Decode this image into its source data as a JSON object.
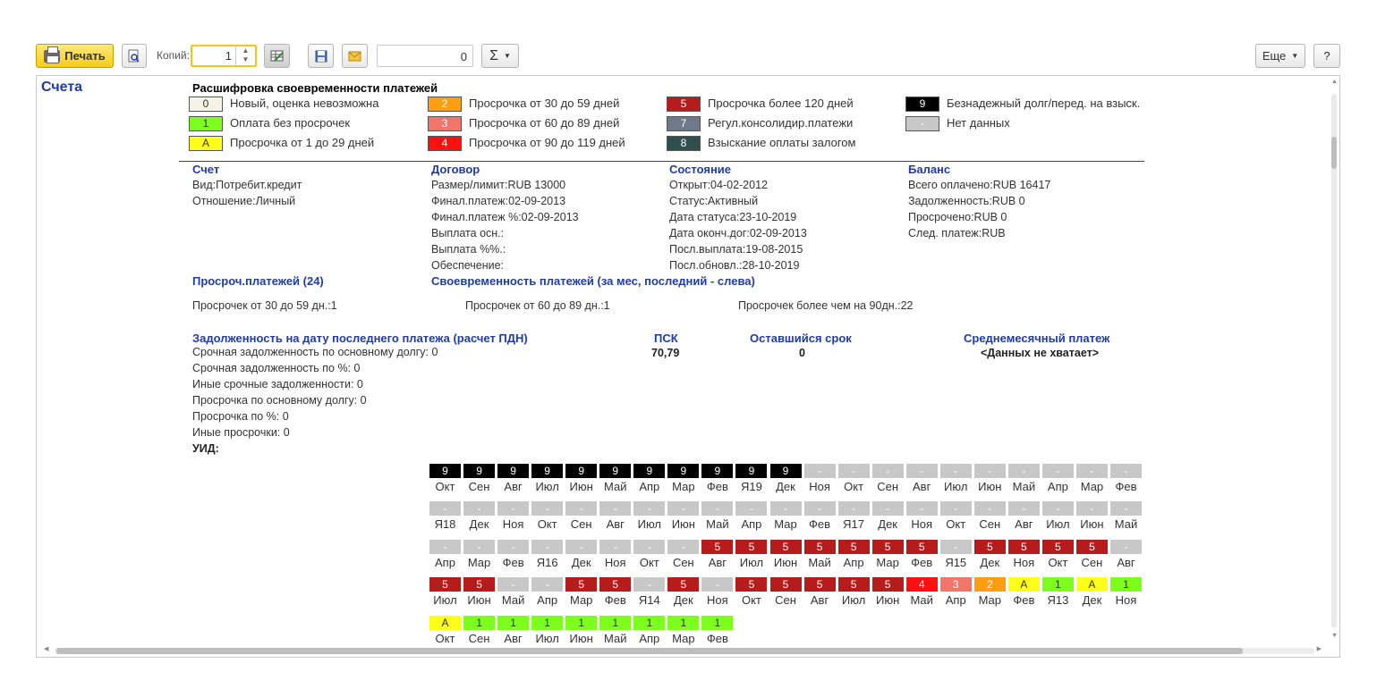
{
  "toolbar": {
    "print_label": "Печать",
    "copies_label": "Копий:",
    "copies_value": "1",
    "sum_value": "0",
    "sigma_label": "Σ",
    "more_label": "Еще",
    "help_label": "?"
  },
  "page_title": "Счета",
  "legend": {
    "title": "Расшифровка своевременности  платежей",
    "items": [
      {
        "code": "0",
        "text": "Новый, оценка невозможна",
        "color": "#f5f3e6",
        "fg": "#333"
      },
      {
        "code": "1",
        "text": "Оплата без просрочек",
        "color": "#7dff1e",
        "fg": "#333"
      },
      {
        "code": "A",
        "text": "Просрочка от 1 до 29 дней",
        "color": "#ffff1a",
        "fg": "#333"
      },
      {
        "code": "2",
        "text": "Просрочка от 30 до 59 дней",
        "color": "#ff9e12",
        "fg": "#fff"
      },
      {
        "code": "3",
        "text": "Просрочка от 60 до 89 дней",
        "color": "#f2756a",
        "fg": "#fff"
      },
      {
        "code": "4",
        "text": "Просрочка от 90 до 119 дней",
        "color": "#ff1010",
        "fg": "#fff"
      },
      {
        "code": "5",
        "text": "Просрочка более 120 дней",
        "color": "#b71c1c",
        "fg": "#fff"
      },
      {
        "code": "7",
        "text": "Регул.консолидир.платежи",
        "color": "#6e7a8a",
        "fg": "#fff"
      },
      {
        "code": "8",
        "text": "Взыскание оплаты залогом",
        "color": "#2f4f4f",
        "fg": "#fff"
      },
      {
        "code": "9",
        "text": "Безнадежный долг/перед. на взыск.",
        "color": "#000000",
        "fg": "#fff"
      },
      {
        "code": "-",
        "text": "Нет данных",
        "color": "#c8c8c8",
        "fg": "#fff"
      }
    ]
  },
  "account": {
    "heading": "Счет",
    "lines": [
      "Вид:Потребит.кредит",
      "Отношение:Личный"
    ]
  },
  "contract": {
    "heading": "Договор",
    "lines": [
      "Размер/лимит:RUB 13000",
      "Финал.платеж:02-09-2013",
      "Финал.платеж %:02-09-2013",
      "Выплата осн.:",
      "Выплата %%.:",
      "Обеспечение:"
    ]
  },
  "state": {
    "heading": "Состояние",
    "lines": [
      "Открыт:04-02-2012",
      "Статус:Активный",
      "Дата статуса:23-10-2019",
      "Дата оконч.дог:02-09-2013",
      "Посл.выплата:19-08-2015",
      "Посл.обновл.:28-10-2019"
    ]
  },
  "balance": {
    "heading": "Баланс",
    "lines": [
      "Всего оплачено:RUB 16417",
      "Задолженность:RUB 0",
      "Просрочено:RUB 0",
      "След. платеж:RUB"
    ]
  },
  "overdue": {
    "heading": "Просроч.платежей (24)",
    "timeliness_heading": "Своевременность платежей (за  мес, последний - слева)",
    "items": [
      "Просрочек от 30 до 59 дн.:1",
      "Просрочек от 60 до 89 дн.:1",
      "Просрочек более чем на 90дн.:22"
    ]
  },
  "debt": {
    "heading": "Задолженность на дату последнего платежа (расчет ПДН)",
    "lines": [
      "Срочная задолженность по основному долгу: 0",
      "Срочная задолженность по %: 0",
      "Иные срочные задолженности: 0",
      "Просрочка по основному долгу: 0",
      "Просрочка по %: 0",
      "Иные просрочки: 0",
      "УИД:"
    ],
    "psk_heading": "ПСК",
    "psk_value": "70,79",
    "term_heading": "Оставшийся срок",
    "term_value": "0",
    "avg_heading": "Среднемесячный платеж",
    "avg_value": "<Данных не хватает>"
  },
  "history": [
    {
      "codes": [
        "9",
        "9",
        "9",
        "9",
        "9",
        "9",
        "9",
        "9",
        "9",
        "9",
        "9",
        "-",
        "-",
        "-",
        "-",
        "-",
        "-",
        "-",
        "-",
        "-",
        "-"
      ],
      "months": [
        "Окт",
        "Сен",
        "Авг",
        "Июл",
        "Июн",
        "Май",
        "Апр",
        "Мар",
        "Фев",
        "Я19",
        "Дек",
        "Ноя",
        "Окт",
        "Сен",
        "Авг",
        "Июл",
        "Июн",
        "Май",
        "Апр",
        "Мар",
        "Фев"
      ]
    },
    {
      "codes": [
        "-",
        "-",
        "-",
        "-",
        "-",
        "-",
        "-",
        "-",
        "-",
        "-",
        "-",
        "-",
        "-",
        "-",
        "-",
        "-",
        "-",
        "-",
        "-",
        "-",
        "-"
      ],
      "months": [
        "Я18",
        "Дек",
        "Ноя",
        "Окт",
        "Сен",
        "Авг",
        "Июл",
        "Июн",
        "Май",
        "Апр",
        "Мар",
        "Фев",
        "Я17",
        "Дек",
        "Ноя",
        "Окт",
        "Сен",
        "Авг",
        "Июл",
        "Июн",
        "Май"
      ]
    },
    {
      "codes": [
        "-",
        "-",
        "-",
        "-",
        "-",
        "-",
        "-",
        "-",
        "5",
        "5",
        "5",
        "5",
        "5",
        "5",
        "5",
        "-",
        "5",
        "5",
        "5",
        "5",
        "-"
      ],
      "months": [
        "Апр",
        "Мар",
        "Фев",
        "Я16",
        "Дек",
        "Ноя",
        "Окт",
        "Сен",
        "Авг",
        "Июл",
        "Июн",
        "Май",
        "Апр",
        "Мар",
        "Фев",
        "Я15",
        "Дек",
        "Ноя",
        "Окт",
        "Сен",
        "Авг"
      ]
    },
    {
      "codes": [
        "5",
        "5",
        "-",
        "-",
        "5",
        "5",
        "-",
        "5",
        "-",
        "5",
        "5",
        "5",
        "5",
        "5",
        "4",
        "3",
        "2",
        "A",
        "1",
        "A",
        "1"
      ],
      "months": [
        "Июл",
        "Июн",
        "Май",
        "Апр",
        "Мар",
        "Фев",
        "Я14",
        "Дек",
        "Ноя",
        "Окт",
        "Сен",
        "Авг",
        "Июл",
        "Июн",
        "Май",
        "Апр",
        "Мар",
        "Фев",
        "Я13",
        "Дек",
        "Ноя"
      ]
    },
    {
      "codes": [
        "A",
        "1",
        "1",
        "1",
        "1",
        "1",
        "1",
        "1",
        "1"
      ],
      "months": [
        "Окт",
        "Сен",
        "Авг",
        "Июл",
        "Июн",
        "Май",
        "Апр",
        "Мар",
        "Фев"
      ]
    }
  ]
}
